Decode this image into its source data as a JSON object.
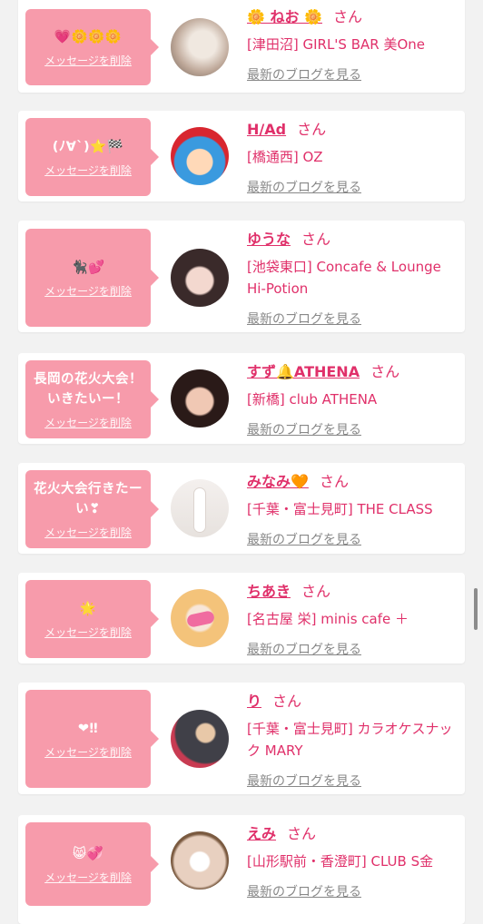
{
  "delete_label": "メッセージを削除",
  "san_label": "さん",
  "blog_label": "最新のブログを見る",
  "entries": [
    {
      "message": "💗🌼🌼🌼",
      "name": "🌼 ねお 🌼",
      "shop": "[津田沼] GIRL'S BAR 美One"
    },
    {
      "message": "(ﾉ∀`)⭐🏁",
      "name": "H/Ad",
      "shop": "[橋通西] OZ"
    },
    {
      "message": "🐈‍⬛💕",
      "name": "ゆうな",
      "shop": "[池袋東口] Concafe & Lounge Hi-Potion"
    },
    {
      "message": "長岡の花火大会！いきたいー！",
      "name": "すず🔔ATHENA",
      "shop": "[新橋] club ATHENA"
    },
    {
      "message": "花火大会行きたーい❣",
      "name": "みなみ🧡",
      "shop": "[千葉・富士見町] THE CLASS"
    },
    {
      "message": "🌟",
      "name": "ちあき",
      "shop": "[名古屋 栄] minis cafe ＋"
    },
    {
      "message": "❤‼",
      "name": "り",
      "shop": "[千葉・富士見町] カラオケスナック MARY"
    },
    {
      "message": "😸💞",
      "name": "えみ",
      "shop": "[山形駅前・香澄町] CLUB S金"
    }
  ]
}
